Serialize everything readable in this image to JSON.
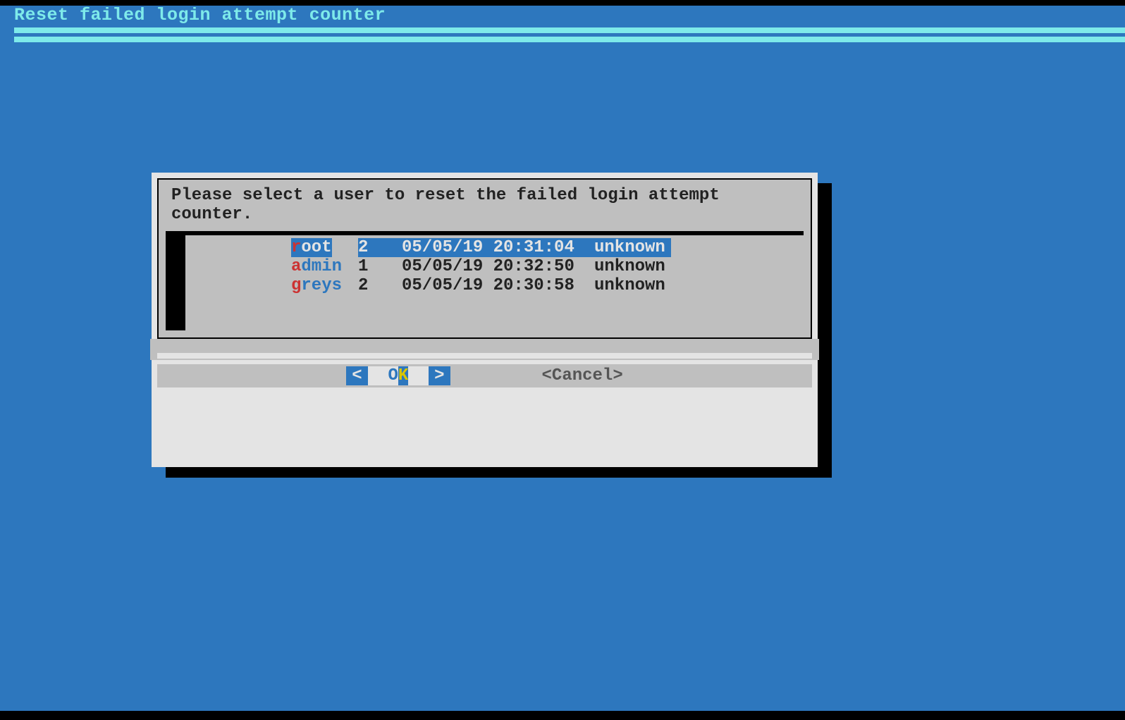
{
  "title": "Reset failed login attempt counter",
  "dialog": {
    "prompt": "Please select a user to reset the failed login attempt counter."
  },
  "users": [
    {
      "name_first": "r",
      "name_rest": "oot",
      "count": "2",
      "timestamp": "05/05/19 20:31:04",
      "source": "unknown",
      "selected": true
    },
    {
      "name_first": "a",
      "name_rest": "dmin",
      "count": "1",
      "timestamp": "05/05/19 20:32:50",
      "source": "unknown",
      "selected": false
    },
    {
      "name_first": "g",
      "name_rest": "reys",
      "count": "2",
      "timestamp": "05/05/19 20:30:58",
      "source": "unknown",
      "selected": false
    }
  ],
  "buttons": {
    "ok_bracket_l": "<",
    "ok_o": "O",
    "ok_k": "K",
    "ok_bracket_r": ">",
    "cancel": "<Cancel>"
  }
}
